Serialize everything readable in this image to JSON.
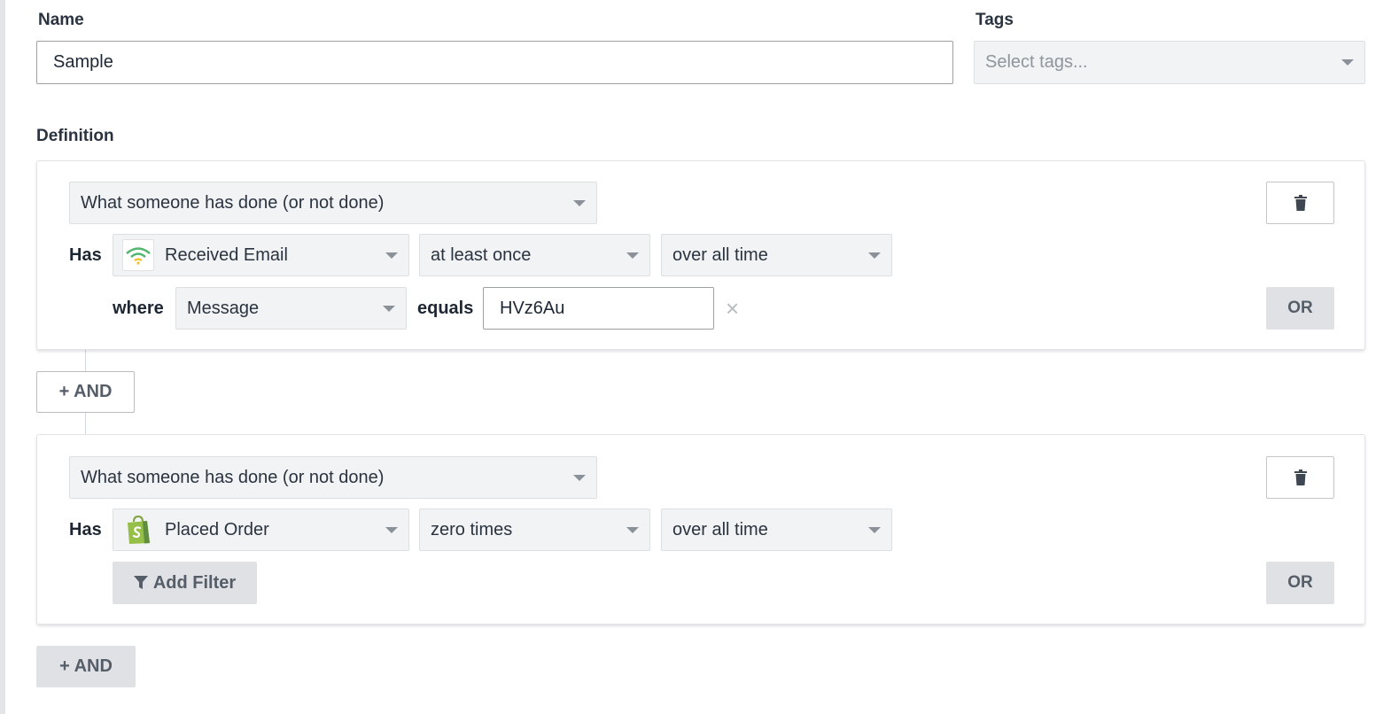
{
  "form": {
    "name_label": "Name",
    "name_value": "Sample",
    "tags_label": "Tags",
    "tags_placeholder": "Select tags...",
    "definition_label": "Definition"
  },
  "conditions": [
    {
      "type_select": "What someone has done (or not done)",
      "has_label": "Has",
      "metric": "Received Email",
      "metric_icon": "email-signal-icon",
      "frequency": "at least once",
      "timeframe": "over all time",
      "filter": {
        "where_label": "where",
        "property": "Message",
        "operator_label": "equals",
        "value": "HVz6Au"
      },
      "or_label": "OR"
    },
    {
      "type_select": "What someone has done (or not done)",
      "has_label": "Has",
      "metric": "Placed Order",
      "metric_icon": "shopify-bag-icon",
      "frequency": "zero times",
      "timeframe": "over all time",
      "add_filter_label": "Add Filter",
      "or_label": "OR"
    }
  ],
  "and_label": "+ AND",
  "colors": {
    "email_icon_green": "#4fb56f",
    "email_icon_yellow": "#f1c232",
    "shopify_green": "#95bf47"
  }
}
